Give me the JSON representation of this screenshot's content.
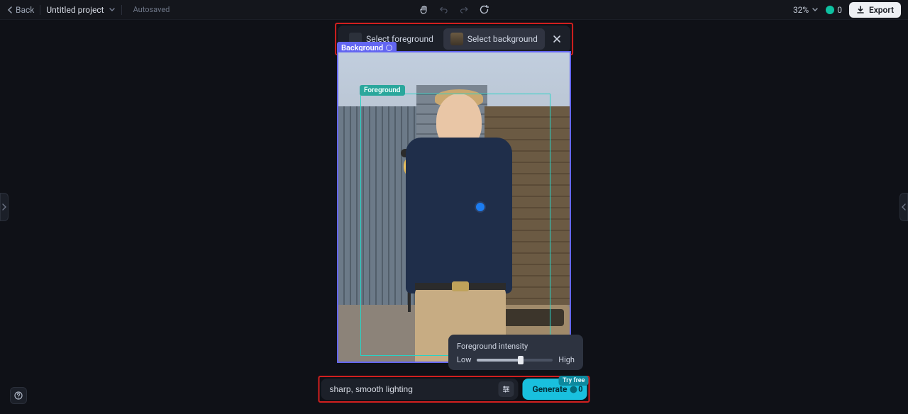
{
  "topbar": {
    "back": "Back",
    "project_name": "Untitled project",
    "autosaved": "Autosaved",
    "zoom": "32%",
    "credits": "0",
    "export": "Export"
  },
  "pill": {
    "foreground": "Select foreground",
    "background": "Select background"
  },
  "canvas": {
    "background_label": "Background",
    "foreground_label": "Foreground"
  },
  "intensity": {
    "title": "Foreground intensity",
    "low": "Low",
    "high": "High"
  },
  "prompt": {
    "value": "sharp, smooth lighting",
    "generate": "Generate",
    "try_free": "Try free",
    "cost": "0"
  }
}
